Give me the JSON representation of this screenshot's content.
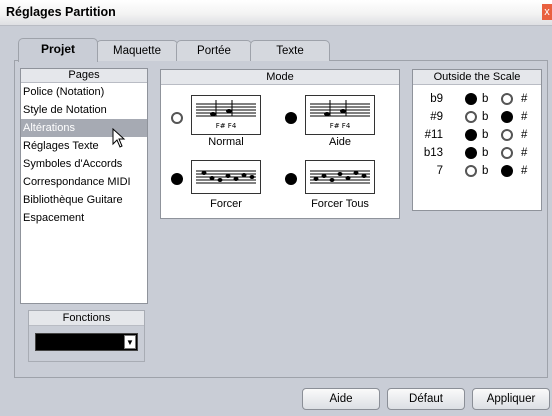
{
  "window": {
    "title": "Réglages Partition",
    "close_glyph": "x"
  },
  "tabs": [
    {
      "label": "Projet",
      "active": true
    },
    {
      "label": "Maquette",
      "active": false
    },
    {
      "label": "Portée",
      "active": false
    },
    {
      "label": "Texte",
      "active": false
    }
  ],
  "pages": {
    "header": "Pages",
    "items": [
      {
        "label": "Police (Notation)"
      },
      {
        "label": "Style de Notation"
      },
      {
        "label": "Altérations",
        "selected": true
      },
      {
        "label": "Réglages Texte"
      },
      {
        "label": "Symboles d'Accords"
      },
      {
        "label": "Correspondance MIDI"
      },
      {
        "label": "Bibliothèque Guitare"
      },
      {
        "label": "Espacement"
      }
    ]
  },
  "fonctions": {
    "header": "Fonctions",
    "value": ""
  },
  "mode": {
    "header": "Mode",
    "staff_text": "F# F4",
    "options": [
      {
        "label": "Normal",
        "selected": false
      },
      {
        "label": "Aide",
        "selected": true
      },
      {
        "label": "Forcer",
        "selected": true
      },
      {
        "label": "Forcer Tous",
        "selected": true
      }
    ]
  },
  "outside_scale": {
    "header": "Outside the Scale",
    "flat_symbol": "b",
    "sharp_symbol": "#",
    "rows": [
      {
        "label": "b9",
        "choice": "flat"
      },
      {
        "label": "#9",
        "choice": "sharp"
      },
      {
        "label": "#11",
        "choice": "flat"
      },
      {
        "label": "b13",
        "choice": "flat"
      },
      {
        "label": "7",
        "choice": "sharp"
      }
    ]
  },
  "buttons": {
    "help": "Aide",
    "default": "Défaut",
    "apply": "Appliquer"
  },
  "colors": {
    "window_bg": "#c9cdd6",
    "selected_item": "#a6aab3",
    "close": "#e9603f"
  }
}
